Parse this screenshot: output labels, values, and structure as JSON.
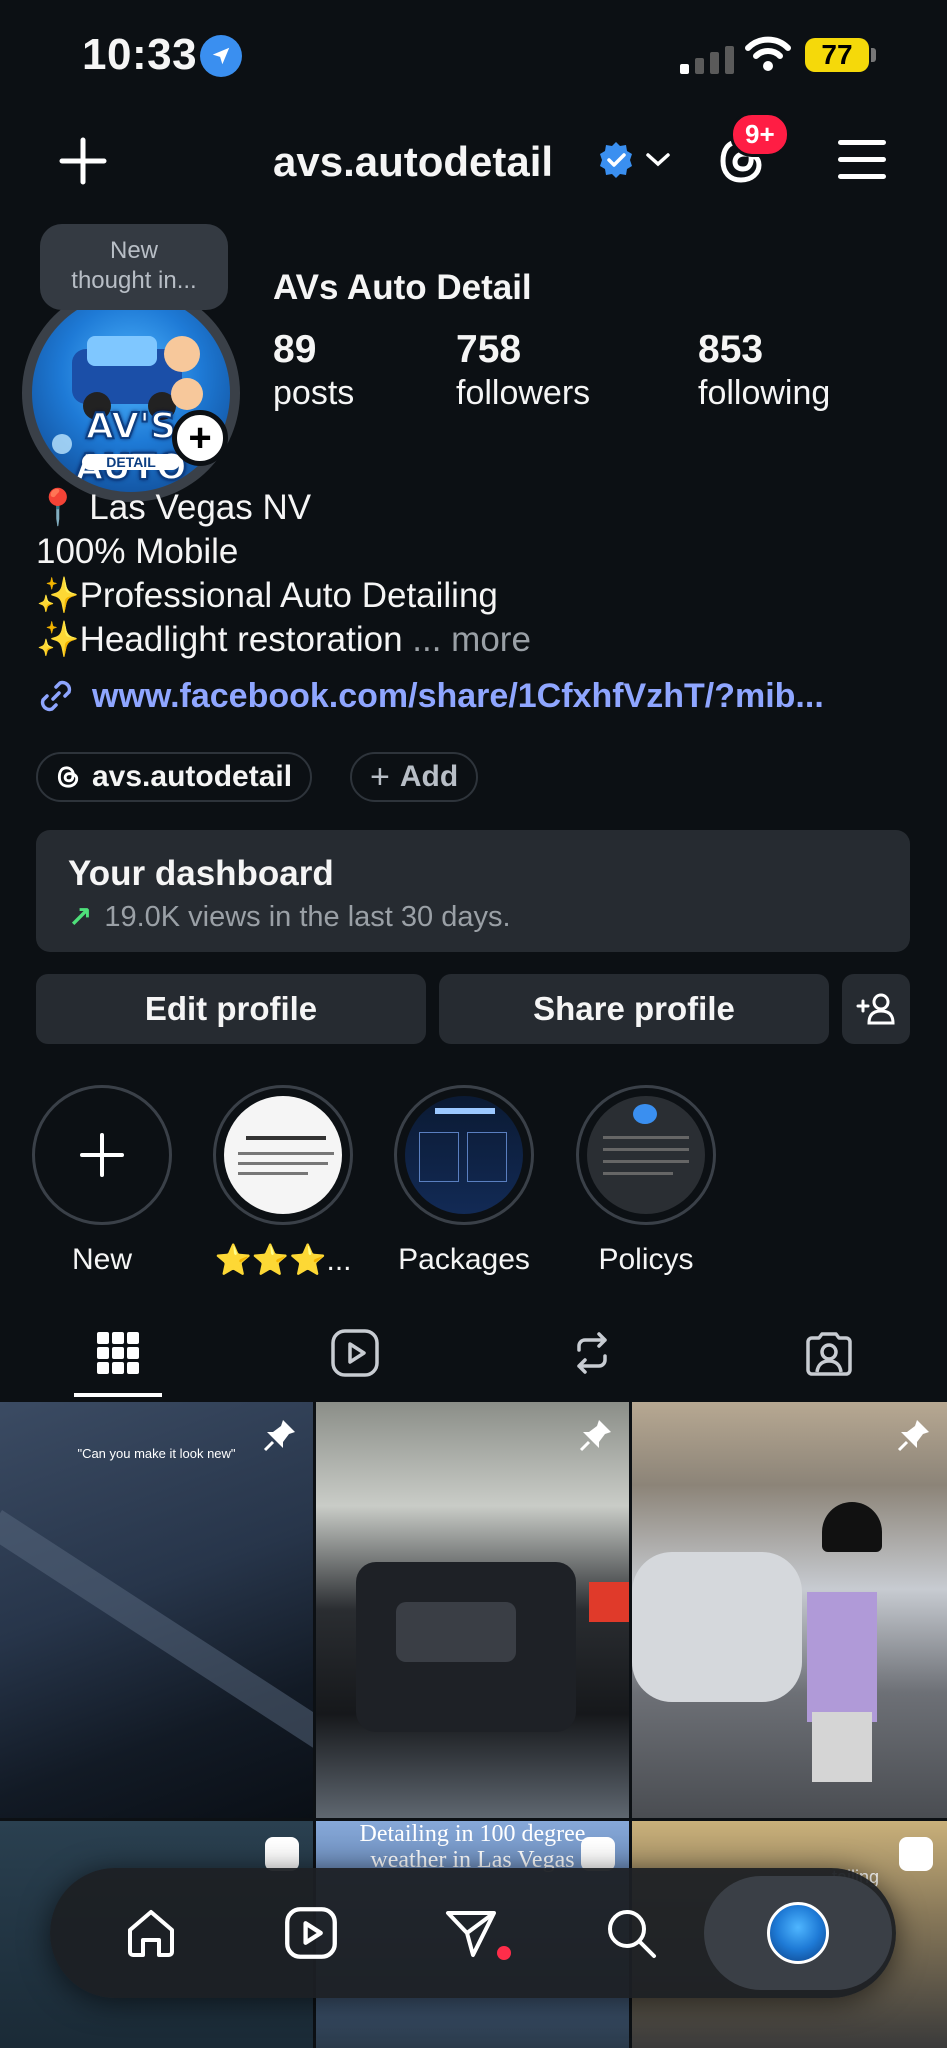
{
  "status_bar": {
    "time": "10:33",
    "battery": "77"
  },
  "header": {
    "username": "avs.autodetail",
    "notification_badge": "9+"
  },
  "profile": {
    "thought_bubble": "New thought in...",
    "thought_line1": "New",
    "thought_line2": "thought in...",
    "avatar_text": "AV'S AUTO",
    "avatar_sub": "DETAIL",
    "display_name": "AVs Auto Detail",
    "stats": [
      {
        "value": "89",
        "label": "posts"
      },
      {
        "value": "758",
        "label": "followers"
      },
      {
        "value": "853",
        "label": "following"
      }
    ],
    "bio": [
      "📍 Las Vegas NV",
      "100% Mobile",
      "✨Professional Auto Detailing",
      "✨Headlight restoration"
    ],
    "bio_more": "... more",
    "link": "www.facebook.com/share/1CfxhfVzhT/?mib...",
    "threads_chip": "avs.autodetail",
    "add_chip": "Add"
  },
  "dashboard": {
    "title": "Your dashboard",
    "subtitle": "19.0K views in the last 30 days."
  },
  "buttons": {
    "edit": "Edit profile",
    "share": "Share profile"
  },
  "highlights": [
    {
      "label": "New"
    },
    {
      "label": "⭐⭐⭐..."
    },
    {
      "label": "Packages"
    },
    {
      "label": "Policys"
    }
  ],
  "grid": {
    "post1_caption": "\"Can you make it look new\"",
    "post5_caption_line1": "Detailing in 100 degree",
    "post5_caption_line2": "weather in Las Vegas",
    "post6_caption": "tailing"
  },
  "colors": {
    "background": "#0c1014",
    "card": "#262b31",
    "link": "#8fa6ff",
    "verified": "#3a8ff0",
    "badge": "#ff1d44",
    "trend": "#4ee07a"
  }
}
